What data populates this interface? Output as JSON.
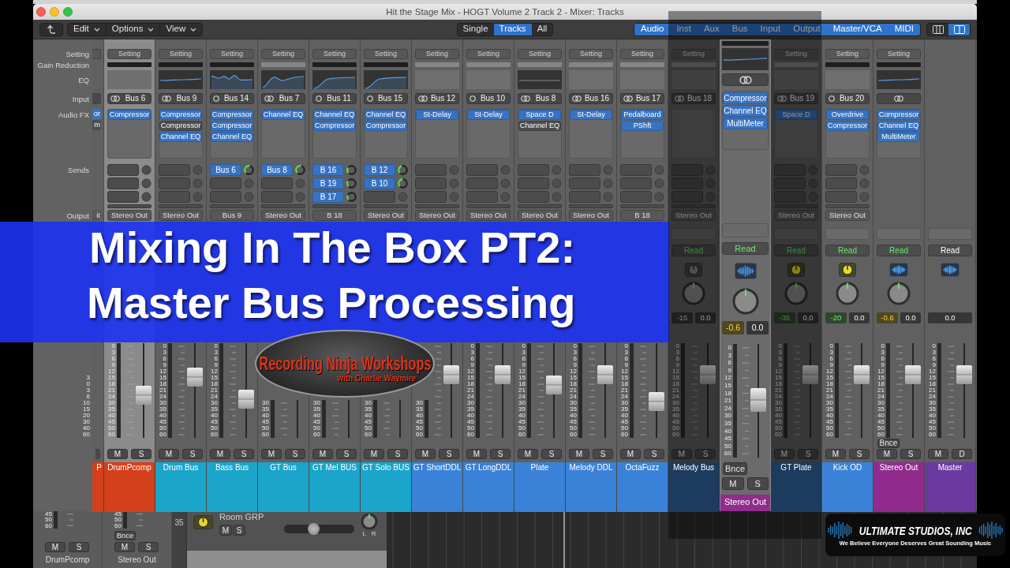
{
  "window": {
    "title": "Hit the Stage Mix - HOGT Volume 2 Track 2 - Mixer: Tracks"
  },
  "toolbar": {
    "menus": [
      "Edit",
      "Options",
      "View"
    ],
    "modes": [
      {
        "label": "Single",
        "selected": false
      },
      {
        "label": "Tracks",
        "selected": true
      },
      {
        "label": "All",
        "selected": false
      }
    ],
    "filters": [
      {
        "label": "Audio",
        "selected": true
      },
      {
        "label": "Inst",
        "selected": true
      },
      {
        "label": "Aux",
        "selected": true
      },
      {
        "label": "Bus",
        "selected": true
      },
      {
        "label": "Input",
        "selected": true
      },
      {
        "label": "Output",
        "selected": true
      },
      {
        "label": "Master/VCA",
        "selected": true
      },
      {
        "label": "MIDI",
        "selected": true
      }
    ],
    "views": [
      {
        "kind": "columns",
        "selected": false
      },
      {
        "kind": "split",
        "selected": true
      }
    ]
  },
  "labels": {
    "rows": [
      "Setting",
      "Gain Reduction",
      "EQ",
      "Input",
      "Audio FX",
      "Sends",
      "Output"
    ],
    "scale": [
      "3",
      "0",
      "3",
      "6",
      "10",
      "15",
      "20",
      "30",
      "40",
      "60"
    ]
  },
  "strips": [
    {
      "kind": "partial",
      "selected": false,
      "fx": [
        {
          "name": "or",
          "bypassed": false
        },
        {
          "name": "m",
          "bypassed": true
        }
      ],
      "output": "it",
      "name": "P",
      "color": "#d2411b"
    },
    {
      "kind": "aux",
      "selected": true,
      "setting": "Setting",
      "gain_reduction": true,
      "input": {
        "label": "Bus 6",
        "stereo": true
      },
      "fx": [
        {
          "name": "Compressor",
          "bypassed": false
        }
      ],
      "output": "Stereo Out",
      "scale": [
        "0",
        "3",
        "6",
        "9",
        "12",
        "15",
        "18",
        "21",
        "24",
        "30",
        "35",
        "40",
        "45",
        "50",
        "60"
      ],
      "fader": {
        "level": 0.45
      },
      "buttons": [
        "M",
        "S"
      ],
      "name": "DrumPcomp",
      "color": "#d2411b"
    },
    {
      "kind": "aux",
      "selected": false,
      "setting": "Setting",
      "gain_reduction": true,
      "eq": {
        "kind": "flat"
      },
      "input": {
        "label": "Bus 9",
        "stereo": true
      },
      "fx": [
        {
          "name": "Compressor",
          "bypassed": false
        },
        {
          "name": "Compressor",
          "bypassed": true
        },
        {
          "name": "Channel EQ",
          "bypassed": false
        }
      ],
      "output": "Stereo Out",
      "scale": [
        "0",
        "3",
        "6",
        "9",
        "12",
        "15",
        "18",
        "21",
        "24",
        "30",
        "35",
        "40",
        "45",
        "50",
        "60"
      ],
      "fader": {
        "level": 0.64
      },
      "buttons": [
        "M",
        "S"
      ],
      "name": "Drum Bus",
      "color": "#1ba5cb"
    },
    {
      "kind": "aux",
      "selected": false,
      "setting": "Setting",
      "gain_reduction": true,
      "eq": {
        "kind": "bumpy"
      },
      "input": {
        "label": "Bus 14",
        "stereo": false
      },
      "fx": [
        {
          "name": "Compressor",
          "bypassed": false
        },
        {
          "name": "Compressor",
          "bypassed": false
        },
        {
          "name": "Channel EQ",
          "bypassed": false
        }
      ],
      "sends": [
        {
          "label": "Bus 6",
          "level": 0.55
        }
      ],
      "output": "Bus 9",
      "scale": [
        "0",
        "3",
        "6",
        "9",
        "12",
        "15",
        "18",
        "21",
        "24",
        "30",
        "35",
        "40",
        "45",
        "50",
        "60"
      ],
      "fader": {
        "level": 0.41
      },
      "buttons": [
        "M",
        "S"
      ],
      "name": "Bass Bus",
      "color": "#1ba5cb"
    },
    {
      "kind": "aux",
      "selected": false,
      "setting": "Setting",
      "gain_reduction": false,
      "eq": {
        "kind": "notch"
      },
      "input": {
        "label": "Bus 7",
        "stereo": true
      },
      "fx": [
        {
          "name": "Channel EQ",
          "bypassed": false
        }
      ],
      "sends": [
        {
          "label": "Bus 8",
          "level": 0.55
        }
      ],
      "output": "Stereo Out",
      "scale": [
        "30",
        "35",
        "40",
        "45",
        "50",
        "60"
      ],
      "buttons": [
        "M",
        "S"
      ],
      "name": "GT Bus",
      "color": "#1ba5cb"
    },
    {
      "kind": "aux",
      "selected": false,
      "setting": "Setting",
      "gain_reduction": true,
      "eq": {
        "kind": "lowcut"
      },
      "input": {
        "label": "Bus 11",
        "stereo": false
      },
      "fx": [
        {
          "name": "Channel EQ",
          "bypassed": false
        },
        {
          "name": "Compressor",
          "bypassed": false
        }
      ],
      "sends": [
        {
          "label": "B 16",
          "level": 0.3
        },
        {
          "label": "B 19",
          "level": 0.3
        },
        {
          "label": "B 17",
          "level": 0.25
        }
      ],
      "output": "B 18",
      "scale": [
        "30",
        "35",
        "40",
        "45",
        "50",
        "60"
      ],
      "buttons": [
        "M",
        "S"
      ],
      "name": "GT Mel BUS",
      "color": "#1ba5cb"
    },
    {
      "kind": "aux",
      "selected": false,
      "setting": "Setting",
      "gain_reduction": true,
      "eq": {
        "kind": "lowcut"
      },
      "input": {
        "label": "Bus 15",
        "stereo": false
      },
      "fx": [
        {
          "name": "Channel EQ",
          "bypassed": false
        },
        {
          "name": "Compressor",
          "bypassed": false
        }
      ],
      "sends": [
        {
          "label": "B 12",
          "level": 0.45
        },
        {
          "label": "B 10",
          "level": 0.5
        }
      ],
      "output": "Stereo Out",
      "scale": [
        "30",
        "35",
        "40",
        "45",
        "50",
        "60"
      ],
      "buttons": [
        "M",
        "S"
      ],
      "name": "GT Solo BUS",
      "color": "#1ba5cb"
    },
    {
      "kind": "aux",
      "selected": false,
      "setting": "Setting",
      "gain_reduction": false,
      "input": {
        "label": "Bus 12",
        "stereo": true
      },
      "fx": [
        {
          "name": "St-Delay",
          "bypassed": false
        }
      ],
      "output": "Stereo Out",
      "scale": [
        "30",
        "35",
        "40",
        "45",
        "50",
        "60"
      ],
      "fader": {
        "level": 0.67
      },
      "buttons": [
        "M",
        "S"
      ],
      "name": "GT ShortDDL",
      "color": "#3a82d8"
    },
    {
      "kind": "aux",
      "selected": false,
      "setting": "Setting",
      "gain_reduction": false,
      "input": {
        "label": "Bus 10",
        "stereo": false
      },
      "fx": [
        {
          "name": "St-Delay",
          "bypassed": false
        }
      ],
      "output": "Stereo Out",
      "scale": [
        "0",
        "3",
        "6",
        "9",
        "12",
        "15",
        "18",
        "21",
        "24",
        "30",
        "35",
        "40",
        "45",
        "50",
        "60"
      ],
      "fader": {
        "level": 0.67
      },
      "buttons": [
        "M",
        "S"
      ],
      "name": "GT LongDDL",
      "color": "#3a82d8"
    },
    {
      "kind": "aux",
      "selected": false,
      "setting": "Setting",
      "gain_reduction": false,
      "eq": {
        "kind": "off"
      },
      "input": {
        "label": "Bus 8",
        "stereo": true
      },
      "fx": [
        {
          "name": "Space D",
          "bypassed": false
        },
        {
          "name": "Channel EQ",
          "bypassed": true
        }
      ],
      "output": "Stereo Out",
      "scale": [
        "0",
        "3",
        "6",
        "9",
        "12",
        "15",
        "18",
        "21",
        "24",
        "30",
        "35",
        "40",
        "45",
        "50",
        "60"
      ],
      "fader": {
        "level": 0.56
      },
      "buttons": [
        "M",
        "S"
      ],
      "name": "Plate",
      "color": "#3a82d8"
    },
    {
      "kind": "aux",
      "selected": false,
      "setting": "Setting",
      "gain_reduction": false,
      "input": {
        "label": "Bus 16",
        "stereo": true
      },
      "fx": [
        {
          "name": "St-Delay",
          "bypassed": false
        }
      ],
      "output": "Stereo Out",
      "scale": [
        "0",
        "3",
        "6",
        "9",
        "12",
        "15",
        "18",
        "21",
        "24",
        "30",
        "35",
        "40",
        "45",
        "50",
        "60"
      ],
      "fader": {
        "level": 0.67
      },
      "buttons": [
        "M",
        "S"
      ],
      "name": "Melody DDL",
      "color": "#3a82d8"
    },
    {
      "kind": "aux",
      "selected": false,
      "setting": "Setting",
      "gain_reduction": false,
      "input": {
        "label": "Bus 17",
        "stereo": true
      },
      "fx": [
        {
          "name": "Pedalboard",
          "bypassed": false
        },
        {
          "name": "PShft",
          "bypassed": false
        }
      ],
      "output": "B 18",
      "scale": [
        "0",
        "3",
        "6",
        "9",
        "12",
        "15",
        "18",
        "21",
        "24",
        "30",
        "35",
        "40",
        "45",
        "50",
        "60"
      ],
      "fader": {
        "level": 0.38
      },
      "buttons": [
        "M",
        "S"
      ],
      "name": "OctaFuzz",
      "color": "#3a82d8"
    },
    {
      "kind": "aux",
      "selected": false,
      "setting": "Setting",
      "gain_reduction": false,
      "input": {
        "label": "Bus 18",
        "stereo": true
      },
      "output": "Stereo Out",
      "mix": {
        "automation": {
          "label": "Read",
          "active": true
        },
        "track_icon": {
          "kind": "dial",
          "on": false
        },
        "pan": {
          "level": 0.5
        },
        "peak": {
          "value": "-15",
          "signal": false,
          "hot": false
        },
        "volume": "0.0"
      },
      "scale": [
        "0",
        "3",
        "6",
        "9",
        "12",
        "15",
        "18",
        "21",
        "24",
        "30",
        "35",
        "40",
        "45",
        "50",
        "60"
      ],
      "fader": {
        "level": 0.67
      },
      "buttons": [
        "M",
        "S"
      ],
      "name": "Melody Bus",
      "color": "#1d3a5f"
    },
    {
      "kind": "focus",
      "selected": false,
      "gain_reduction": true,
      "eq": {
        "kind": "flat"
      },
      "input": {
        "stereo": true
      },
      "fx": [
        {
          "name": "Compressor",
          "bypassed": false
        },
        {
          "name": "Channel EQ",
          "bypassed": false
        },
        {
          "name": "MultiMeter",
          "bypassed": false
        }
      ],
      "mix": {
        "automation": {
          "label": "Read",
          "active": true
        },
        "track_icon": {
          "kind": "waveform",
          "on": true
        },
        "pan": {
          "level": 0.5
        },
        "peak": {
          "value": "-0.6",
          "signal": false,
          "hot": true
        },
        "volume": "0.0"
      },
      "scale": [
        "0",
        "3",
        "6",
        "9",
        "12",
        "15",
        "18",
        "21",
        "24",
        "30",
        "35",
        "40",
        "45",
        "50",
        "60"
      ],
      "fader": {
        "level": 0.51
      },
      "bounce": "Bnce",
      "buttons": [
        "M",
        "S"
      ],
      "name": "Stereo Out",
      "color": "#912c8c"
    },
    {
      "kind": "aux",
      "selected": false,
      "setting": "Setting",
      "gain_reduction": false,
      "input": {
        "label": "Bus 19",
        "stereo": true
      },
      "fx": [
        {
          "name": "Space D",
          "bypassed": false
        }
      ],
      "output": "Stereo Out",
      "mix": {
        "automation": {
          "label": "Read",
          "active": true
        },
        "track_icon": {
          "kind": "dial",
          "on": true
        },
        "pan": {
          "level": 0.5
        },
        "peak": {
          "value": "-35",
          "signal": true,
          "hot": false
        },
        "volume": "0.0"
      },
      "scale": [
        "0",
        "3",
        "6",
        "9",
        "12",
        "15",
        "18",
        "21",
        "24",
        "30",
        "35",
        "40",
        "45",
        "50",
        "60"
      ],
      "fader": {
        "level": 0.67
      },
      "buttons": [
        "M",
        "S"
      ],
      "name": "GT Plate",
      "color": "#1d3a5f"
    },
    {
      "kind": "aux",
      "selected": false,
      "setting": "Setting",
      "gain_reduction": true,
      "input": {
        "label": "Bus 20",
        "stereo": false
      },
      "fx": [
        {
          "name": "Overdrive",
          "bypassed": false
        },
        {
          "name": "Compressor",
          "bypassed": false
        }
      ],
      "output": "Stereo Out",
      "mix": {
        "automation": {
          "label": "Read",
          "active": true
        },
        "track_icon": {
          "kind": "dial",
          "on": true
        },
        "pan": {
          "level": 0.5
        },
        "peak": {
          "value": "-20",
          "signal": true,
          "hot": false
        },
        "volume": "0.0"
      },
      "scale": [
        "0",
        "3",
        "6",
        "9",
        "12",
        "15",
        "18",
        "21",
        "24",
        "30",
        "35",
        "40",
        "45",
        "50",
        "60"
      ],
      "fader": {
        "level": 0.67
      },
      "buttons": [
        "M",
        "S"
      ],
      "name": "Kick OD",
      "color": "#3a82d8"
    },
    {
      "kind": "output",
      "selected": false,
      "setting": "Setting",
      "gain_reduction": true,
      "eq": {
        "kind": "flat"
      },
      "input": {
        "stereo": true
      },
      "fx": [
        {
          "name": "Compressor",
          "bypassed": false
        },
        {
          "name": "Channel EQ",
          "bypassed": false
        },
        {
          "name": "MultiMeter",
          "bypassed": false
        }
      ],
      "mix": {
        "automation": {
          "label": "Read",
          "active": true
        },
        "track_icon": {
          "kind": "waveform",
          "on": true
        },
        "pan": {
          "level": 0.5
        },
        "peak": {
          "value": "-0.6",
          "signal": false,
          "hot": true
        },
        "volume": "0.0"
      },
      "scale": [
        "0",
        "3",
        "6",
        "9",
        "12",
        "15",
        "18",
        "21",
        "24",
        "30",
        "35",
        "40",
        "45",
        "50",
        "60"
      ],
      "fader": {
        "level": 0.67
      },
      "bounce": "Bnce",
      "buttons": [
        "M",
        "S"
      ],
      "name": "Stereo Out",
      "color": "#912c8c"
    },
    {
      "kind": "master",
      "selected": false,
      "mix": {
        "automation": {
          "label": "Read",
          "active": false
        },
        "track_icon": {
          "kind": "waveform",
          "on": true
        },
        "volume": "0.0"
      },
      "scale": [
        "0",
        "3",
        "6",
        "9",
        "12",
        "15",
        "18",
        "21",
        "24",
        "30",
        "35",
        "40",
        "45",
        "50",
        "60"
      ],
      "fader": {
        "level": 0.67
      },
      "buttons": [
        "M",
        "D"
      ],
      "name": "Master",
      "color": "#6b3aa0"
    }
  ],
  "lower_strips": [
    {
      "scale": [
        "45",
        "50",
        "60"
      ],
      "buttons": [
        "M",
        "S"
      ],
      "name": "DrumPcomp"
    },
    {
      "scale": [
        "45",
        "50",
        "60"
      ],
      "bounce": "Bnce",
      "buttons": [
        "M",
        "S"
      ],
      "name": "Stereo Out"
    }
  ],
  "track": {
    "number": "35",
    "track_icon": {
      "kind": "dial",
      "on": true
    },
    "name": "Room GRP",
    "buttons": [
      "M",
      "S"
    ],
    "volume": {
      "level": 0.41
    },
    "pan": {
      "level": 0.5,
      "labels": [
        "L",
        "R"
      ]
    }
  },
  "banner": {
    "lines": [
      "Mixing In The Box PT2:",
      "Master Bus Processing"
    ]
  },
  "logo": {
    "title": "Recording Ninja Workshops",
    "subtitle": "with Charlie Waymire"
  },
  "brand": {
    "name": "ULTIMATE STUDIOS, INC",
    "tagline": "We Believe Everyone Deserves Great Sounding Music"
  }
}
